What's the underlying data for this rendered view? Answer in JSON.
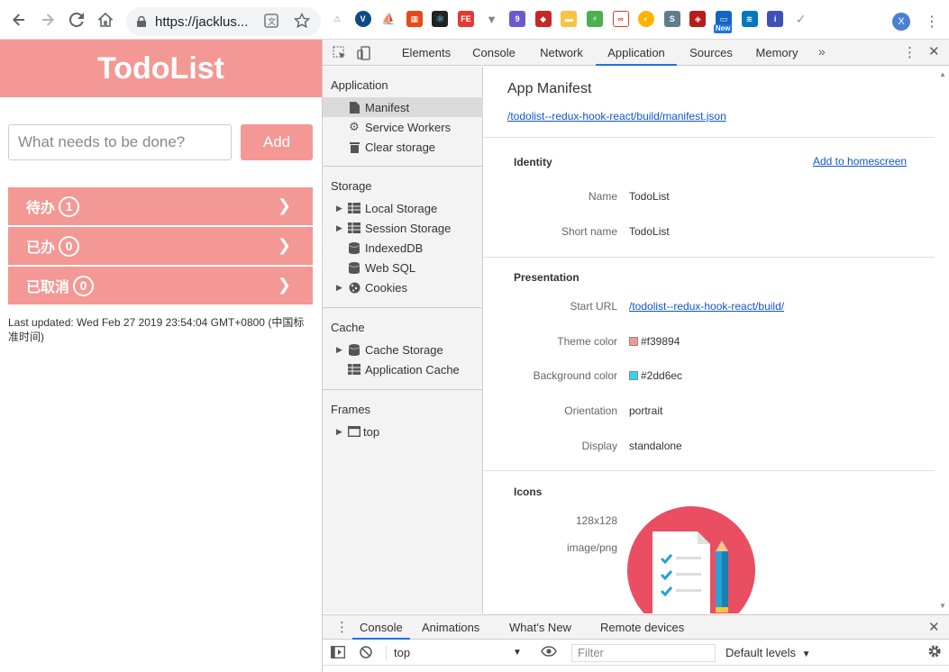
{
  "browser": {
    "url": "https://jacklus...",
    "avatar_letter": "X"
  },
  "app": {
    "title": "TodoList",
    "input_placeholder": "What needs to be done?",
    "add_label": "Add",
    "categories": [
      {
        "label": "待办",
        "count": "1"
      },
      {
        "label": "已办",
        "count": "0"
      },
      {
        "label": "已取消",
        "count": "0"
      }
    ],
    "updated": "Last updated: Wed Feb 27 2019 23:54:04 GMT+0800 (中国标准时间)"
  },
  "devtools": {
    "tabs": [
      "Elements",
      "Console",
      "Network",
      "Application",
      "Sources",
      "Memory"
    ],
    "active_tab": "Application",
    "sidebar": {
      "application_title": "Application",
      "application_items": [
        "Manifest",
        "Service Workers",
        "Clear storage"
      ],
      "storage_title": "Storage",
      "storage_items": [
        "Local Storage",
        "Session Storage",
        "IndexedDB",
        "Web SQL",
        "Cookies"
      ],
      "cache_title": "Cache",
      "cache_items": [
        "Cache Storage",
        "Application Cache"
      ],
      "frames_title": "Frames",
      "frames_items": [
        "top"
      ]
    },
    "manifest": {
      "title": "App Manifest",
      "link": "/todolist--redux-hook-react/build/manifest.json",
      "identity_title": "Identity",
      "add_homescreen": "Add to homescreen",
      "name_label": "Name",
      "name_value": "TodoList",
      "short_name_label": "Short name",
      "short_name_value": "TodoList",
      "presentation_title": "Presentation",
      "start_url_label": "Start URL",
      "start_url_value": "/todolist--redux-hook-react/build/",
      "theme_color_label": "Theme color",
      "theme_color_value": "#f39894",
      "bg_color_label": "Background color",
      "bg_color_value": "#2dd6ec",
      "orientation_label": "Orientation",
      "orientation_value": "portrait",
      "display_label": "Display",
      "display_value": "standalone",
      "icons_title": "Icons",
      "icon_size": "128x128",
      "icon_type": "image/png"
    },
    "drawer": {
      "tabs": [
        "Console",
        "Animations",
        "What's New",
        "Remote devices"
      ],
      "context": "top",
      "filter_placeholder": "Filter",
      "levels": "Default levels"
    }
  },
  "colors": {
    "brand": "#f39894",
    "accent": "#1a73e8",
    "icon_bg": "#e94e62"
  }
}
